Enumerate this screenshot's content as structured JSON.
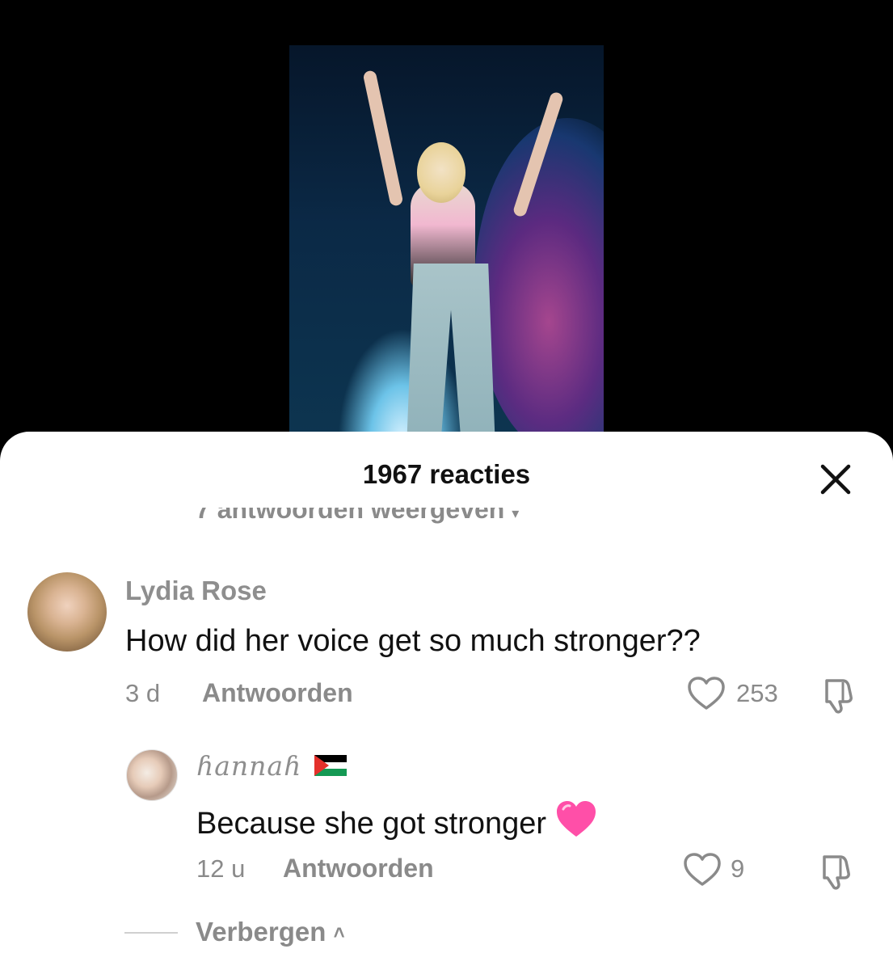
{
  "sheet": {
    "title": "1967 reacties",
    "close_icon": "close-icon",
    "partial_replies_link": "7 antwoorden weergeven"
  },
  "comments": [
    {
      "username": "Lydia Rose",
      "text": "How did her voice get so much stronger??",
      "time": "3 d",
      "reply_label": "Antwoorden",
      "likes": "253",
      "avatar_icon": "avatar"
    }
  ],
  "replies": [
    {
      "username": "ɦannaɦ",
      "flag": "palestine-flag-icon",
      "text": "Because she got stronger",
      "emoji": "💗",
      "time": "12 u",
      "reply_label": "Antwoorden",
      "likes": "9"
    }
  ],
  "hide_replies_label": "Verbergen",
  "colors": {
    "muted": "#8a8a8a",
    "text": "#111111",
    "pink_heart": "#ff4fa8"
  }
}
